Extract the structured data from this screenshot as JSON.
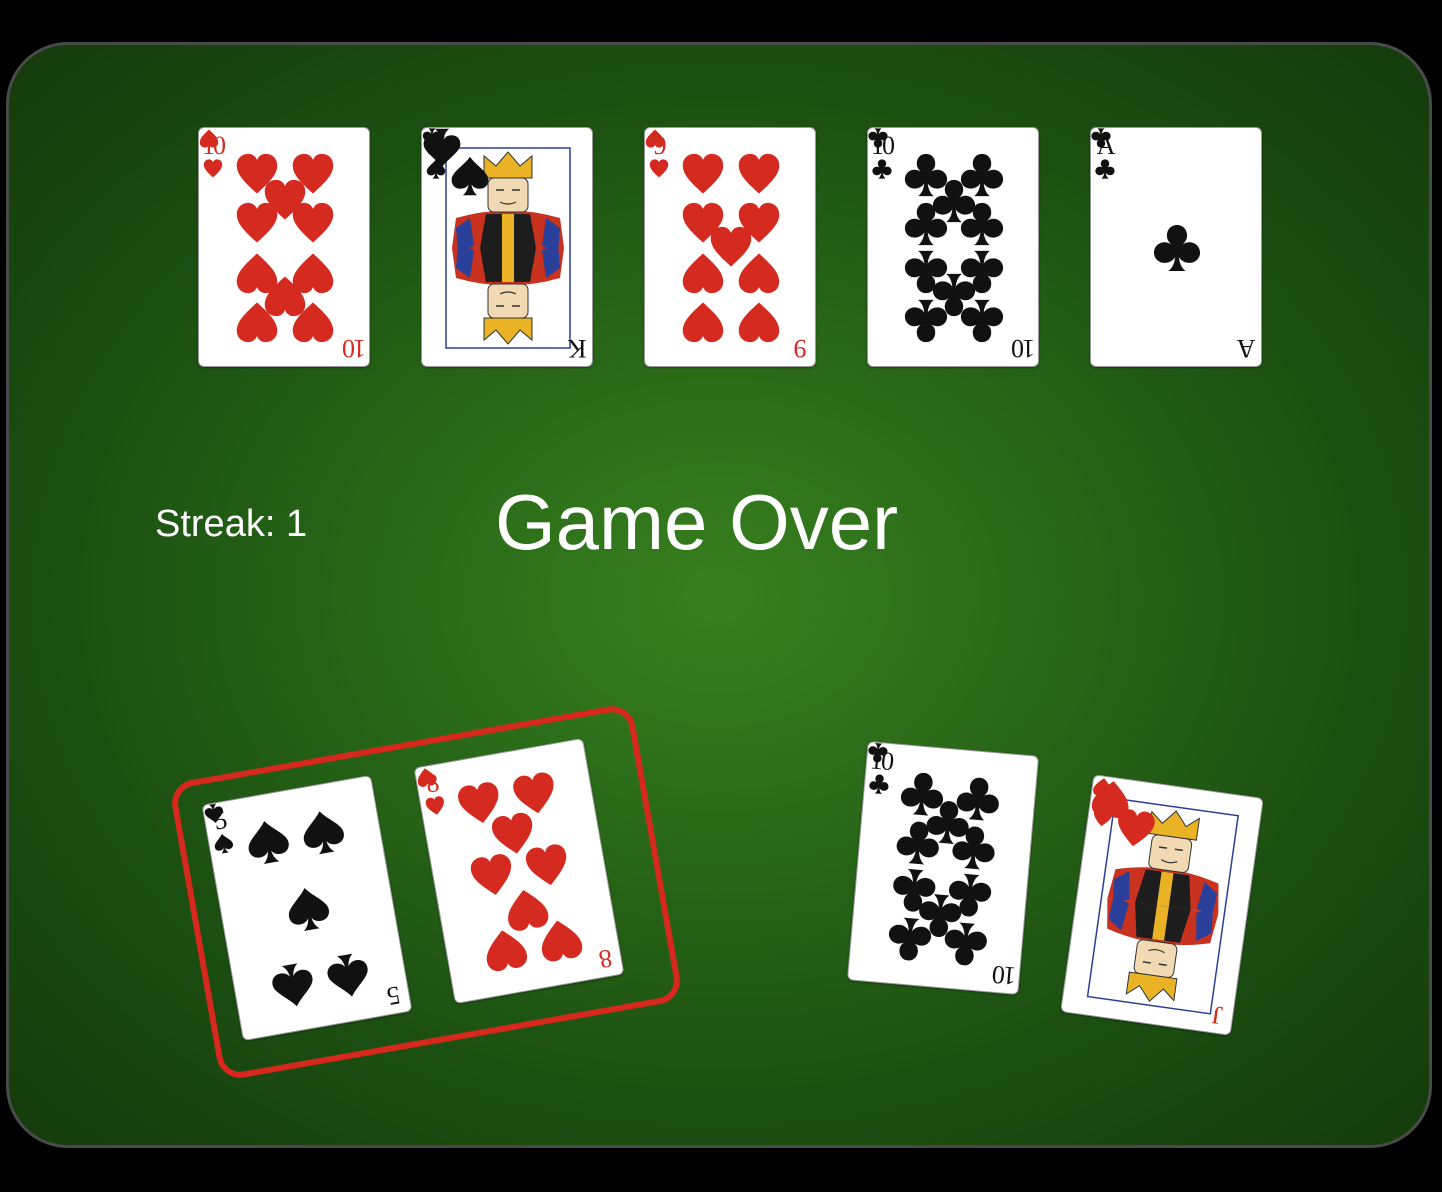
{
  "game": {
    "streak_text": "Streak: 1",
    "status_text": "Game Over"
  },
  "colors": {
    "felt": "#2a6a18",
    "winner_outline": "#d6281d",
    "red_suit": "#d42a1f",
    "black_suit": "#111111"
  },
  "community_cards": [
    {
      "rank": "10",
      "suit": "hearts"
    },
    {
      "rank": "K",
      "suit": "spades"
    },
    {
      "rank": "9",
      "suit": "hearts"
    },
    {
      "rank": "10",
      "suit": "clubs"
    },
    {
      "rank": "A",
      "suit": "clubs"
    }
  ],
  "player_hand": {
    "highlighted_as_winner": true,
    "cards": [
      {
        "rank": "5",
        "suit": "spades"
      },
      {
        "rank": "8",
        "suit": "hearts"
      }
    ]
  },
  "opponent_hand": {
    "highlighted_as_winner": false,
    "cards": [
      {
        "rank": "10",
        "suit": "clubs"
      },
      {
        "rank": "J",
        "suit": "hearts"
      }
    ]
  }
}
